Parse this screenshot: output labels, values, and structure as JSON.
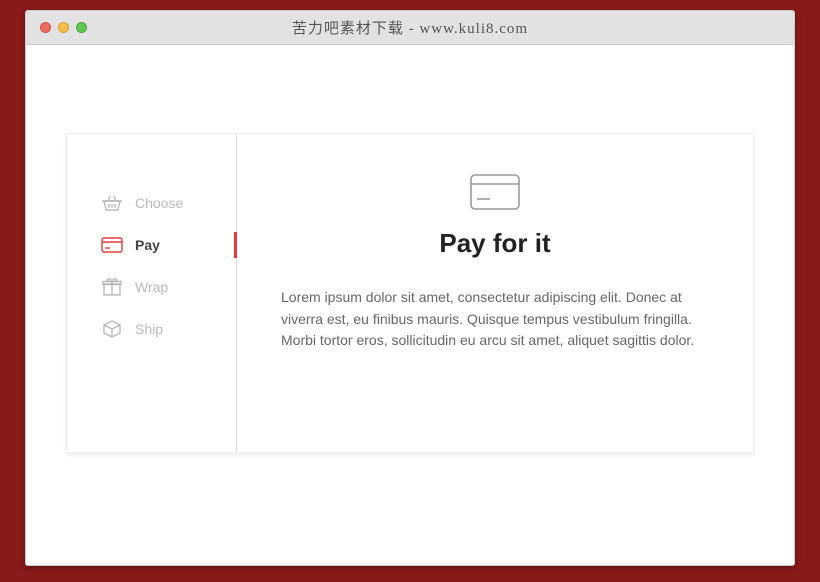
{
  "window": {
    "title": "苦力吧素材下载 - www.kuli8.com"
  },
  "tabs": [
    {
      "label": "Choose",
      "icon": "basket-icon",
      "active": false
    },
    {
      "label": "Pay",
      "icon": "card-icon",
      "active": true
    },
    {
      "label": "Wrap",
      "icon": "gift-icon",
      "active": false
    },
    {
      "label": "Ship",
      "icon": "box-icon",
      "active": false
    }
  ],
  "content": {
    "heading": "Pay for it",
    "body": "Lorem ipsum dolor sit amet, consectetur adipiscing elit. Donec at viverra est, eu finibus mauris. Quisque tempus vestibulum fringilla. Morbi tortor eros, sollicitudin eu arcu sit amet, aliquet sagittis dolor."
  }
}
